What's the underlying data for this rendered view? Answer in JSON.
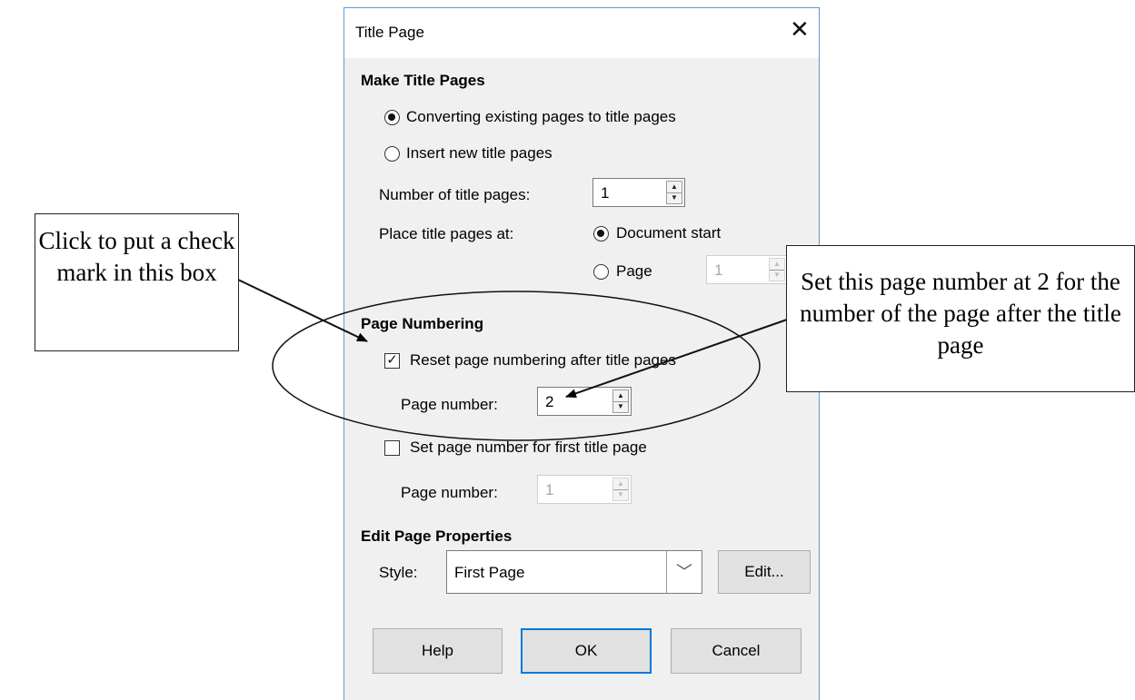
{
  "dialog": {
    "title": "Title Page",
    "close_glyph": "✕",
    "make_title_pages": {
      "heading": "Make Title Pages",
      "convert_option": "Converting existing pages to title pages",
      "insert_option": "Insert new title pages",
      "number_label": "Number of title pages:",
      "number_value": "1",
      "place_label": "Place title pages at:",
      "document_start_option": "Document start",
      "page_option": "Page",
      "page_value": "1"
    },
    "page_numbering": {
      "heading": "Page Numbering",
      "reset_label": "Reset page numbering after title pages",
      "reset_checked_glyph": "✓",
      "page_number_label": "Page number:",
      "page_number_value": "2",
      "set_first_label": "Set page number for first title page",
      "first_page_number_label": "Page number:",
      "first_page_number_value": "1"
    },
    "edit_page_properties": {
      "heading": "Edit Page Properties",
      "style_label": "Style:",
      "style_value": "First Page",
      "edit_button": "Edit..."
    },
    "buttons": {
      "help": "Help",
      "ok": "OK",
      "cancel": "Cancel"
    }
  },
  "annotations": {
    "left_callout": "Click to put a check mark in this box",
    "right_callout": "Set this page number at 2 for the number of the page after the title page"
  },
  "icons": {
    "spin_up": "▲",
    "spin_down": "▼",
    "dropdown": "﹀"
  }
}
